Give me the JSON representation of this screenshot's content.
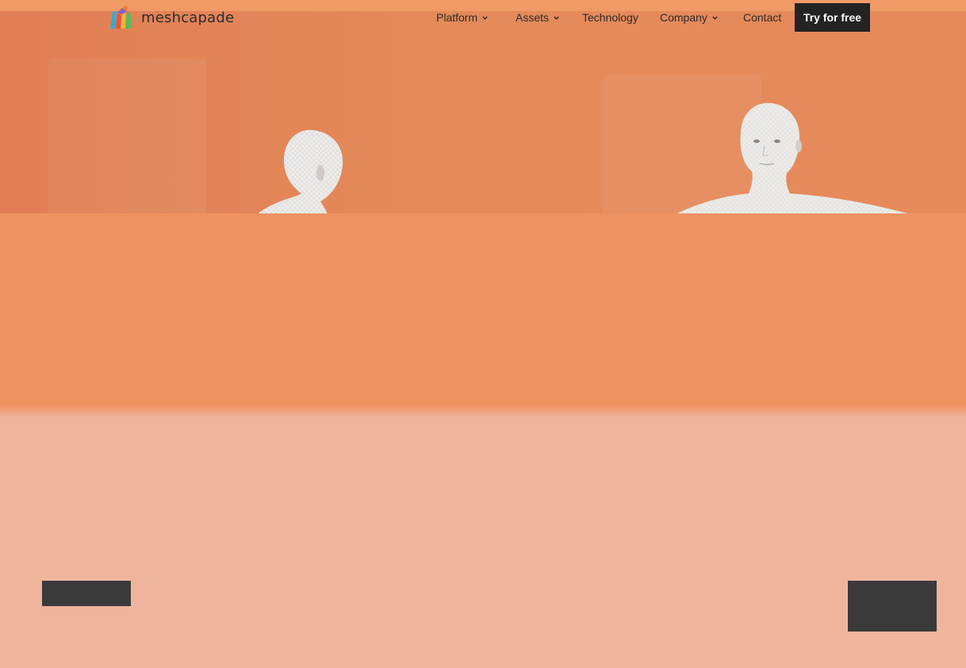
{
  "brand": {
    "name": "meshcapade",
    "logo_icon": "meshcapade-logo-icon"
  },
  "nav": {
    "items": [
      {
        "label": "Platform",
        "has_dropdown": true
      },
      {
        "label": "Assets",
        "has_dropdown": true
      },
      {
        "label": "Technology",
        "has_dropdown": false
      },
      {
        "label": "Company",
        "has_dropdown": true
      },
      {
        "label": "Contact",
        "has_dropdown": false
      }
    ],
    "cta_label": "Try for free"
  },
  "colors": {
    "hero_orange": "#e48a5a",
    "band_orange": "#ee9262",
    "lower_peach": "#efb49c",
    "cta_dark": "#232323",
    "placeholder_gray": "#3a3a3a"
  },
  "icons": {
    "dropdown": "chevron-down-icon"
  }
}
